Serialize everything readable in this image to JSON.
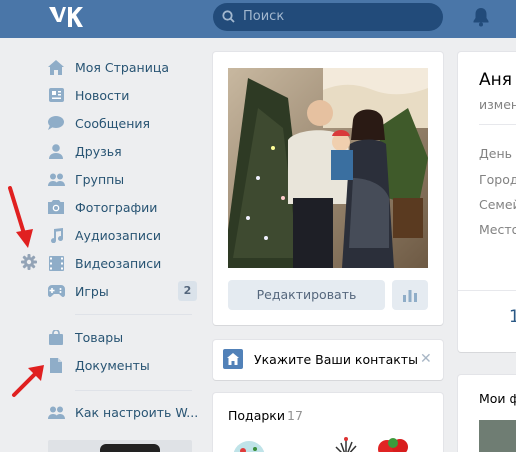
{
  "header": {
    "search_placeholder": "Поиск"
  },
  "nav": {
    "items": [
      {
        "label": "Моя Страница",
        "icon": "home-icon"
      },
      {
        "label": "Новости",
        "icon": "news-icon"
      },
      {
        "label": "Сообщения",
        "icon": "messages-icon"
      },
      {
        "label": "Друзья",
        "icon": "friends-icon"
      },
      {
        "label": "Группы",
        "icon": "groups-icon"
      },
      {
        "label": "Фотографии",
        "icon": "camera-icon"
      },
      {
        "label": "Аудиозаписи",
        "icon": "music-icon"
      },
      {
        "label": "Видеозаписи",
        "icon": "video-icon"
      },
      {
        "label": "Игры",
        "icon": "gamepad-icon",
        "badge": "2"
      },
      {
        "label": "Товары",
        "icon": "shopping-bag-icon"
      },
      {
        "label": "Документы",
        "icon": "document-icon"
      },
      {
        "label": "Как настроить W...",
        "icon": "group-help-icon"
      }
    ]
  },
  "profile": {
    "edit_label": "Редактировать",
    "contacts_prompt": "Укажите Ваши контакты",
    "gifts_title": "Подарки",
    "gifts_count": "17"
  },
  "right": {
    "name": "Аня",
    "status": "измен",
    "fields": [
      "День р",
      "Город:",
      "Семей",
      "Место"
    ],
    "count": "1",
    "photos_title": "Мои ф"
  },
  "colors": {
    "header": "#4a76a8",
    "link": "#285473",
    "accent": "#5181b8",
    "arrow": "#e02020"
  }
}
